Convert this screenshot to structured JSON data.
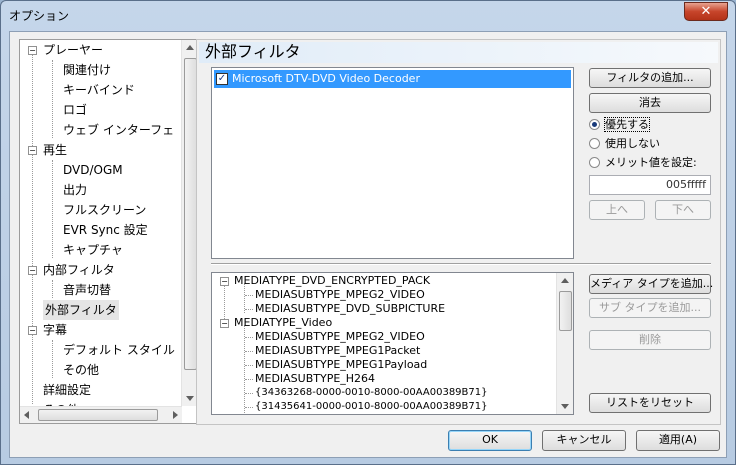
{
  "window": {
    "title": "オプション",
    "close_label": "✕"
  },
  "tree": {
    "items": [
      {
        "label": "プレーヤー",
        "level": 0,
        "expander": "−"
      },
      {
        "label": "関連付け",
        "level": 1
      },
      {
        "label": "キーバインド",
        "level": 1
      },
      {
        "label": "ロゴ",
        "level": 1
      },
      {
        "label": "ウェブ インターフェ",
        "level": 1
      },
      {
        "label": "再生",
        "level": 0,
        "expander": "−"
      },
      {
        "label": "DVD/OGM",
        "level": 1
      },
      {
        "label": "出力",
        "level": 1
      },
      {
        "label": "フルスクリーン",
        "level": 1
      },
      {
        "label": "EVR Sync 設定",
        "level": 1
      },
      {
        "label": "キャプチャ",
        "level": 1
      },
      {
        "label": "内部フィルタ",
        "level": 0,
        "expander": "−"
      },
      {
        "label": "音声切替",
        "level": 1
      },
      {
        "label": "外部フィルタ",
        "level": 0,
        "selected": true
      },
      {
        "label": "字幕",
        "level": 0,
        "expander": "−"
      },
      {
        "label": "デフォルト スタイル",
        "level": 1
      },
      {
        "label": "その他",
        "level": 1
      },
      {
        "label": "詳細設定",
        "level": 0
      },
      {
        "label": "その他",
        "level": 0
      }
    ]
  },
  "page": {
    "title": "外部フィルタ",
    "filters": [
      {
        "label": "Microsoft DTV-DVD Video Decoder",
        "checked": true
      }
    ],
    "buttons": {
      "add_filter": "フィルタの追加...",
      "remove": "消去",
      "up": "上へ",
      "down": "下へ",
      "add_media_type": "メディア タイプを追加...",
      "add_subtype": "サブ タイプを追加...",
      "delete": "削除",
      "reset_list": "リストをリセット"
    },
    "radios": [
      {
        "label": "優先する",
        "selected": true
      },
      {
        "label": "使用しない",
        "selected": false
      },
      {
        "label": "メリット値を設定:",
        "selected": false
      }
    ],
    "merit_value": "005fffff",
    "media_tree": [
      {
        "label": "MEDIATYPE_DVD_ENCRYPTED_PACK",
        "level": 0
      },
      {
        "label": "MEDIASUBTYPE_MPEG2_VIDEO",
        "level": 1
      },
      {
        "label": "MEDIASUBTYPE_DVD_SUBPICTURE",
        "level": 1
      },
      {
        "label": "MEDIATYPE_Video",
        "level": 0
      },
      {
        "label": "MEDIASUBTYPE_MPEG2_VIDEO",
        "level": 1
      },
      {
        "label": "MEDIASUBTYPE_MPEG1Packet",
        "level": 1
      },
      {
        "label": "MEDIASUBTYPE_MPEG1Payload",
        "level": 1
      },
      {
        "label": "MEDIASUBTYPE_H264",
        "level": 1
      },
      {
        "label": "{34363268-0000-0010-8000-00AA00389B71}",
        "level": 1
      },
      {
        "label": "{31435641-0000-0010-8000-00AA00389B71}",
        "level": 1
      }
    ]
  },
  "footer": {
    "ok": "OK",
    "cancel": "キャンセル",
    "apply": "適用(A)"
  },
  "colors": {
    "selection": "#3399ff",
    "close_button": "#c7452b"
  }
}
